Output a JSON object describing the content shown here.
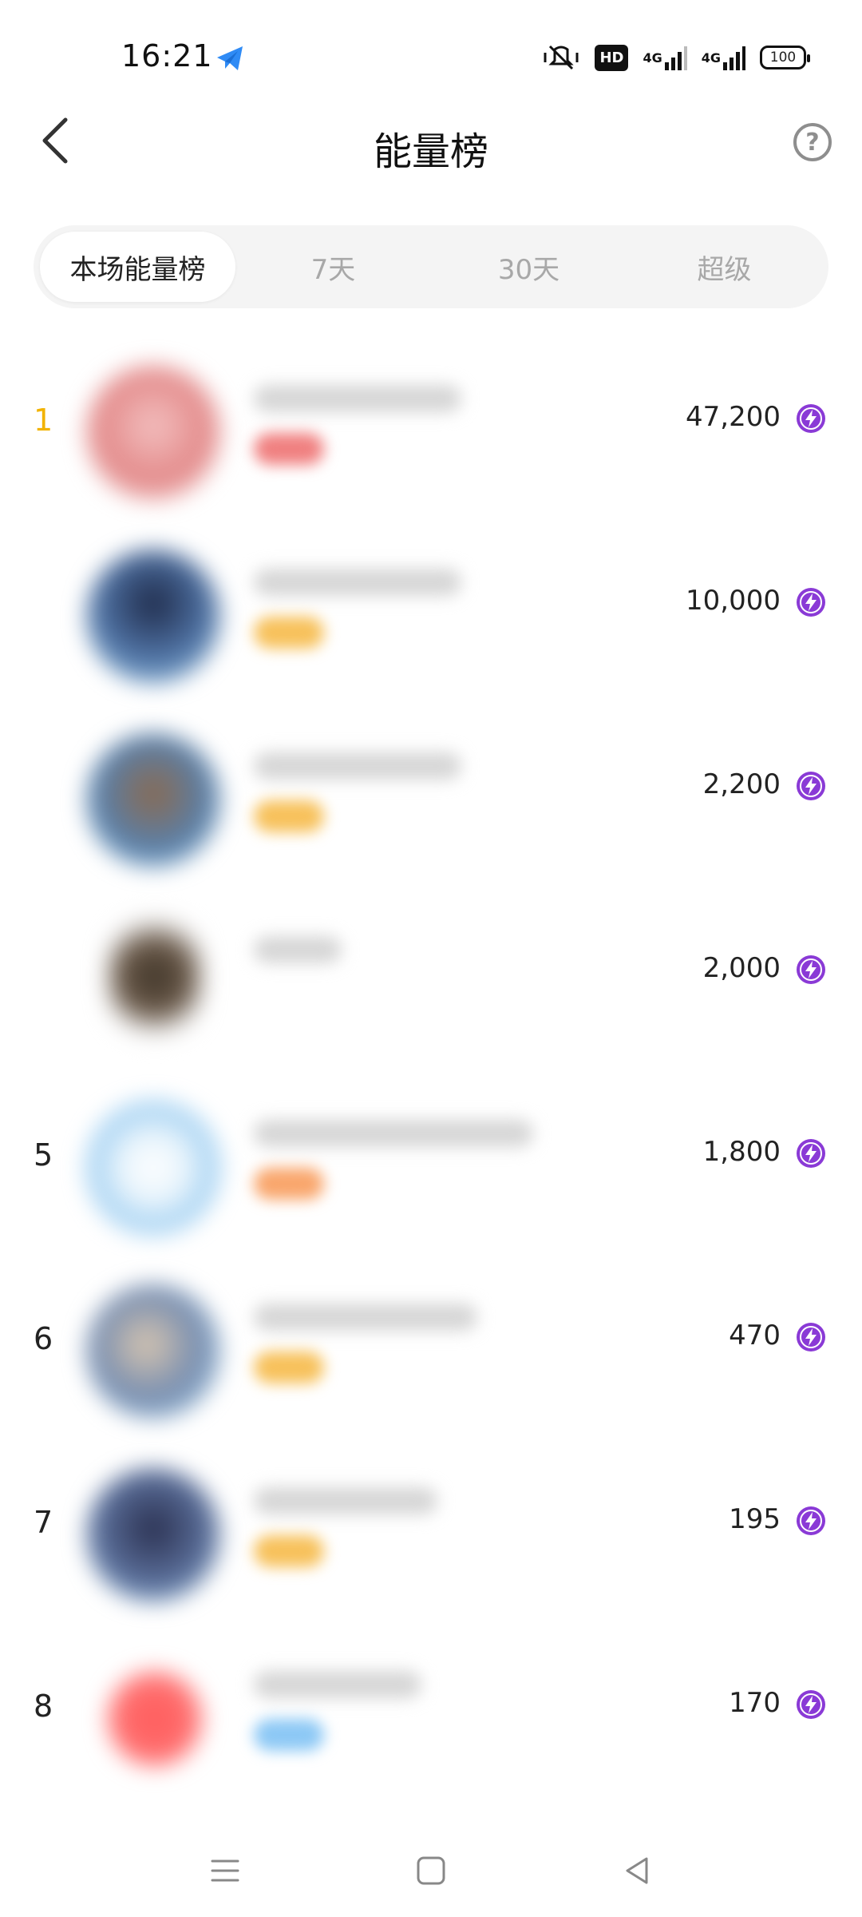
{
  "status_bar": {
    "time": "16:21",
    "hd_label": "HD",
    "net1": "4G",
    "net2": "4G",
    "battery": "100"
  },
  "header": {
    "title": "能量榜",
    "back_icon": "chevron-left-icon",
    "help_icon": "question-circle-icon",
    "help_glyph": "?"
  },
  "tabs": [
    {
      "label": "本场能量榜",
      "active": true
    },
    {
      "label": "7天",
      "active": false
    },
    {
      "label": "30天",
      "active": false
    },
    {
      "label": "超级",
      "active": false
    }
  ],
  "ranking": [
    {
      "rank": "1",
      "score": "47,200",
      "avatar_color": "#e38a8a",
      "badge_color": "#f08080"
    },
    {
      "rank": "",
      "score": "10,000",
      "avatar_color": "#4d6fa0",
      "badge_color": "#f7c15b"
    },
    {
      "rank": "",
      "score": "2,200",
      "avatar_color": "#5a7fa8",
      "badge_color": "#f7c15b"
    },
    {
      "rank": "",
      "score": "2,000",
      "avatar_color": "#6b5a4a",
      "badge_color": "#ffffff"
    },
    {
      "rank": "5",
      "score": "1,800",
      "avatar_color": "#8ec6ef",
      "badge_color": "#f9a66c"
    },
    {
      "rank": "6",
      "score": "470",
      "avatar_color": "#7a8fb0",
      "badge_color": "#f7c15b"
    },
    {
      "rank": "7",
      "score": "195",
      "avatar_color": "#5b6f9a",
      "badge_color": "#f7c15b"
    },
    {
      "rank": "8",
      "score": "170",
      "avatar_color": "#ff5b5b",
      "badge_color": "#8cc8f5"
    }
  ],
  "energy_icon": "lightning-bolt-icon",
  "colors": {
    "accent_purple": "#8a3ad6",
    "gold_rank": "#f2b300"
  },
  "bottom_nav": {
    "menu_icon": "menu-icon",
    "home_icon": "square-home-icon",
    "back_icon": "triangle-back-icon"
  }
}
